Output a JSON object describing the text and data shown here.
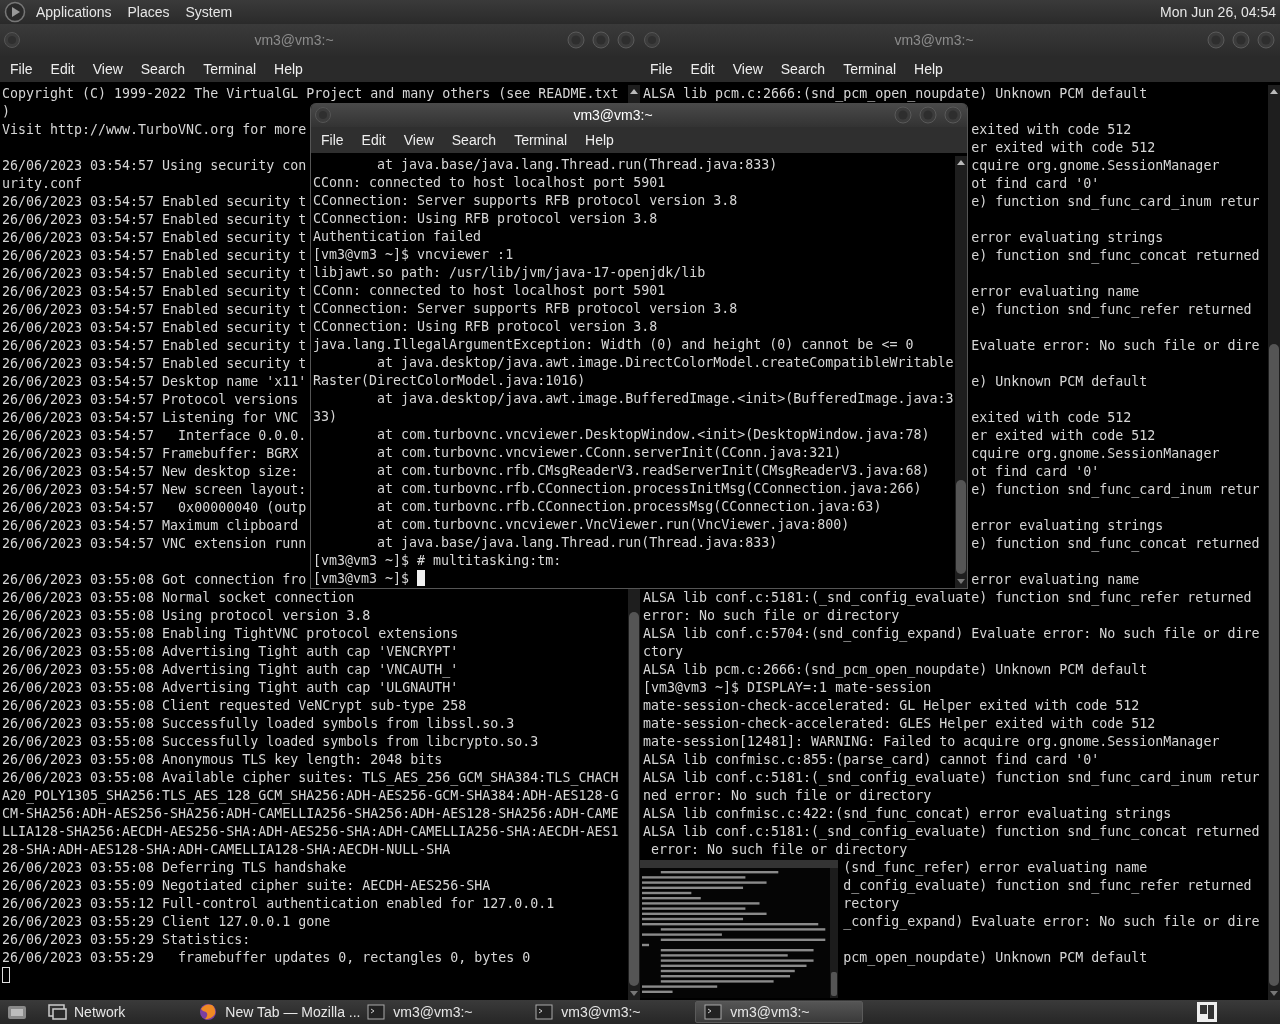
{
  "top_panel": {
    "menus": [
      "Applications",
      "Places",
      "System"
    ],
    "clock": "Mon Jun 26, 04:54"
  },
  "windows": [
    {
      "title": "vm3@vm3:~",
      "active": false,
      "menu": [
        "File",
        "Edit",
        "View",
        "Search",
        "Terminal",
        "Help"
      ],
      "lines": [
        {
          "kind": "line",
          "text": "Copyright (C) 1999-2022 The VirtualGL Project and many others (see README.txt"
        },
        {
          "kind": "line",
          "text": ")"
        },
        {
          "kind": "line",
          "text": "Visit http://www.TurboVNC.org for more"
        },
        {
          "kind": "blank"
        },
        {
          "kind": "line",
          "text": "26/06/2023 03:54:57 Using security con"
        },
        {
          "kind": "line",
          "text": "urity.conf"
        },
        {
          "kind": "line",
          "text": "26/06/2023 03:54:57 Enabled security t"
        },
        {
          "kind": "line",
          "text": "26/06/2023 03:54:57 Enabled security t"
        },
        {
          "kind": "line",
          "text": "26/06/2023 03:54:57 Enabled security t"
        },
        {
          "kind": "line",
          "text": "26/06/2023 03:54:57 Enabled security t"
        },
        {
          "kind": "line",
          "text": "26/06/2023 03:54:57 Enabled security t"
        },
        {
          "kind": "line",
          "text": "26/06/2023 03:54:57 Enabled security t"
        },
        {
          "kind": "line",
          "text": "26/06/2023 03:54:57 Enabled security t"
        },
        {
          "kind": "line",
          "text": "26/06/2023 03:54:57 Enabled security t"
        },
        {
          "kind": "line",
          "text": "26/06/2023 03:54:57 Enabled security t"
        },
        {
          "kind": "line",
          "text": "26/06/2023 03:54:57 Enabled security t"
        },
        {
          "kind": "line",
          "text": "26/06/2023 03:54:57 Desktop name 'x11'"
        },
        {
          "kind": "line",
          "text": "26/06/2023 03:54:57 Protocol versions"
        },
        {
          "kind": "line",
          "text": "26/06/2023 03:54:57 Listening for VNC"
        },
        {
          "kind": "line",
          "text": "26/06/2023 03:54:57   Interface 0.0.0."
        },
        {
          "kind": "line",
          "text": "26/06/2023 03:54:57 Framebuffer: BGRX"
        },
        {
          "kind": "line",
          "text": "26/06/2023 03:54:57 New desktop size:"
        },
        {
          "kind": "line",
          "text": "26/06/2023 03:54:57 New screen layout:"
        },
        {
          "kind": "line",
          "text": "26/06/2023 03:54:57   0x00000040 (outp"
        },
        {
          "kind": "line",
          "text": "26/06/2023 03:54:57 Maximum clipboard"
        },
        {
          "kind": "line",
          "text": "26/06/2023 03:54:57 VNC extension runn"
        },
        {
          "kind": "blank"
        },
        {
          "kind": "line",
          "text": "26/06/2023 03:55:08 Got connection fro"
        },
        {
          "kind": "line",
          "text": "26/06/2023 03:55:08 Normal socket connection"
        },
        {
          "kind": "line",
          "text": "26/06/2023 03:55:08 Using protocol version 3.8"
        },
        {
          "kind": "line",
          "text": "26/06/2023 03:55:08 Enabling TightVNC protocol extensions"
        },
        {
          "kind": "line",
          "text": "26/06/2023 03:55:08 Advertising Tight auth cap 'VENCRYPT'"
        },
        {
          "kind": "line",
          "text": "26/06/2023 03:55:08 Advertising Tight auth cap 'VNCAUTH_'"
        },
        {
          "kind": "line",
          "text": "26/06/2023 03:55:08 Advertising Tight auth cap 'ULGNAUTH'"
        },
        {
          "kind": "line",
          "text": "26/06/2023 03:55:08 Client requested VeNCrypt sub-type 258"
        },
        {
          "kind": "line",
          "text": "26/06/2023 03:55:08 Successfully loaded symbols from libssl.so.3"
        },
        {
          "kind": "line",
          "text": "26/06/2023 03:55:08 Successfully loaded symbols from libcrypto.so.3"
        },
        {
          "kind": "line",
          "text": "26/06/2023 03:55:08 Anonymous TLS key length: 2048 bits"
        },
        {
          "kind": "line",
          "text": "26/06/2023 03:55:08 Available cipher suites: TLS_AES_256_GCM_SHA384:TLS_CHACH"
        },
        {
          "kind": "line",
          "text": "A20_POLY1305_SHA256:TLS_AES_128_GCM_SHA256:ADH-AES256-GCM-SHA384:ADH-AES128-G"
        },
        {
          "kind": "line",
          "text": "CM-SHA256:ADH-AES256-SHA256:ADH-CAMELLIA256-SHA256:ADH-AES128-SHA256:ADH-CAME"
        },
        {
          "kind": "line",
          "text": "LLIA128-SHA256:AECDH-AES256-SHA:ADH-AES256-SHA:ADH-CAMELLIA256-SHA:AECDH-AES1"
        },
        {
          "kind": "line",
          "text": "28-SHA:ADH-AES128-SHA:ADH-CAMELLIA128-SHA:AECDH-NULL-SHA"
        },
        {
          "kind": "line",
          "text": "26/06/2023 03:55:08 Deferring TLS handshake"
        },
        {
          "kind": "line",
          "text": "26/06/2023 03:55:09 Negotiated cipher suite: AECDH-AES256-SHA"
        },
        {
          "kind": "line",
          "text": "26/06/2023 03:55:12 Full-control authentication enabled for 127.0.0.1"
        },
        {
          "kind": "line",
          "text": "26/06/2023 03:55:29 Client 127.0.0.1 gone"
        },
        {
          "kind": "line",
          "text": "26/06/2023 03:55:29 Statistics:"
        },
        {
          "kind": "line",
          "text": "26/06/2023 03:55:29   framebuffer updates 0, rectangles 0, bytes 0"
        },
        {
          "kind": "line",
          "cursor": true
        }
      ]
    },
    {
      "title": "vm3@vm3:~",
      "active": false,
      "menu": [
        "File",
        "Edit",
        "View",
        "Search",
        "Terminal",
        "Help"
      ],
      "lines": [
        {
          "kind": "line",
          "text": "ALSA lib pcm.c:2666:(snd_pcm_open_noupdate) Unknown PCM default"
        },
        {
          "kind": "covered"
        },
        {
          "kind": "behind-window",
          "text": "exited with code 512"
        },
        {
          "kind": "behind-window",
          "text": "er exited with code 512"
        },
        {
          "kind": "behind-window",
          "text": "cquire org.gnome.SessionManager"
        },
        {
          "kind": "behind-window",
          "text": "ot find card '0'"
        },
        {
          "kind": "behind-window",
          "text": "e) function snd_func_card_inum retur"
        },
        {
          "kind": "covered"
        },
        {
          "kind": "behind-window",
          "text": "error evaluating strings"
        },
        {
          "kind": "behind-window",
          "text": "e) function snd_func_concat returned"
        },
        {
          "kind": "covered"
        },
        {
          "kind": "behind-window",
          "text": "error evaluating name"
        },
        {
          "kind": "behind-window",
          "text": "e) function snd_func_refer returned"
        },
        {
          "kind": "covered"
        },
        {
          "kind": "behind-window",
          "text": "Evaluate error: No such file or dire"
        },
        {
          "kind": "covered"
        },
        {
          "kind": "behind-window",
          "text": "e) Unknown PCM default"
        },
        {
          "kind": "covered"
        },
        {
          "kind": "behind-window",
          "text": "exited with code 512"
        },
        {
          "kind": "behind-window",
          "text": "er exited with code 512"
        },
        {
          "kind": "behind-window",
          "text": "cquire org.gnome.SessionManager"
        },
        {
          "kind": "behind-window",
          "text": "ot find card '0'"
        },
        {
          "kind": "behind-window",
          "text": "e) function snd_func_card_inum retur"
        },
        {
          "kind": "covered"
        },
        {
          "kind": "behind-window",
          "text": "error evaluating strings"
        },
        {
          "kind": "behind-window",
          "text": "e) function snd_func_concat returned"
        },
        {
          "kind": "covered"
        },
        {
          "kind": "behind-window",
          "text": "error evaluating name"
        },
        {
          "kind": "line",
          "text": "ALSA lib conf.c:5181:(_snd_config_evaluate) function snd_func_refer returned"
        },
        {
          "kind": "line",
          "text": "error: No such file or directory"
        },
        {
          "kind": "line",
          "text": "ALSA lib conf.c:5704:(snd_config_expand) Evaluate error: No such file or dire"
        },
        {
          "kind": "line",
          "text": "ctory"
        },
        {
          "kind": "line",
          "text": "ALSA lib pcm.c:2666:(snd_pcm_open_noupdate) Unknown PCM default"
        },
        {
          "kind": "line",
          "text": "[vm3@vm3 ~]$ DISPLAY=:1 mate-session"
        },
        {
          "kind": "line",
          "text": "mate-session-check-accelerated: GL Helper exited with code 512"
        },
        {
          "kind": "line",
          "text": "mate-session-check-accelerated: GLES Helper exited with code 512"
        },
        {
          "kind": "line",
          "text": "mate-session[12481]: WARNING: Failed to acquire org.gnome.SessionManager"
        },
        {
          "kind": "line",
          "text": "ALSA lib confmisc.c:855:(parse_card) cannot find card '0'"
        },
        {
          "kind": "line",
          "text": "ALSA lib conf.c:5181:(_snd_config_evaluate) function snd_func_card_inum retur"
        },
        {
          "kind": "line",
          "text": "ned error: No such file or directory"
        },
        {
          "kind": "line",
          "text": "ALSA lib confmisc.c:422:(snd_func_concat) error evaluating strings"
        },
        {
          "kind": "line",
          "text": "ALSA lib conf.c:5181:(_snd_config_evaluate) function snd_func_concat returned"
        },
        {
          "kind": "line",
          "text": " error: No such file or directory"
        },
        {
          "kind": "behind-preview",
          "text": "(snd_func_refer) error evaluating name"
        },
        {
          "kind": "behind-preview",
          "text": "d_config_evaluate) function snd_func_refer returned"
        },
        {
          "kind": "behind-preview",
          "text": "rectory"
        },
        {
          "kind": "behind-preview",
          "text": "_config_expand) Evaluate error: No such file or dire"
        },
        {
          "kind": "covered"
        },
        {
          "kind": "behind-preview",
          "text": "pcm_open_noupdate) Unknown PCM default"
        }
      ]
    },
    {
      "title": "vm3@vm3:~",
      "active": true,
      "menu": [
        "File",
        "Edit",
        "View",
        "Search",
        "Terminal",
        "Help"
      ],
      "lines": [
        {
          "kind": "line",
          "text": "        at java.base/java.lang.Thread.run(Thread.java:833)"
        },
        {
          "kind": "line",
          "text": "CConn: connected to host localhost port 5901"
        },
        {
          "kind": "line",
          "text": "CConnection: Server supports RFB protocol version 3.8"
        },
        {
          "kind": "line",
          "text": "CConnection: Using RFB protocol version 3.8"
        },
        {
          "kind": "line",
          "text": "Authentication failed"
        },
        {
          "kind": "line",
          "text": "[vm3@vm3 ~]$ vncviewer :1"
        },
        {
          "kind": "line",
          "text": "libjawt.so path: /usr/lib/jvm/java-17-openjdk/lib"
        },
        {
          "kind": "line",
          "text": "CConn: connected to host localhost port 5901"
        },
        {
          "kind": "line",
          "text": "CConnection: Server supports RFB protocol version 3.8"
        },
        {
          "kind": "line",
          "text": "CConnection: Using RFB protocol version 3.8"
        },
        {
          "kind": "line",
          "text": "java.lang.IllegalArgumentException: Width (0) and height (0) cannot be <= 0"
        },
        {
          "kind": "line",
          "text": "        at java.desktop/java.awt.image.DirectColorModel.createCompatibleWritable"
        },
        {
          "kind": "line",
          "text": "Raster(DirectColorModel.java:1016)"
        },
        {
          "kind": "line",
          "text": "        at java.desktop/java.awt.image.BufferedImage.<init>(BufferedImage.java:3"
        },
        {
          "kind": "line",
          "text": "33)"
        },
        {
          "kind": "line",
          "text": "        at com.turbovnc.vncviewer.DesktopWindow.<init>(DesktopWindow.java:78)"
        },
        {
          "kind": "line",
          "text": "        at com.turbovnc.vncviewer.CConn.serverInit(CConn.java:321)"
        },
        {
          "kind": "line",
          "text": "        at com.turbovnc.rfb.CMsgReaderV3.readServerInit(CMsgReaderV3.java:68)"
        },
        {
          "kind": "line",
          "text": "        at com.turbovnc.rfb.CConnection.processInitMsg(CConnection.java:266)"
        },
        {
          "kind": "line",
          "text": "        at com.turbovnc.rfb.CConnection.processMsg(CConnection.java:63)"
        },
        {
          "kind": "line",
          "text": "        at com.turbovnc.vncviewer.VncViewer.run(VncViewer.java:800)"
        },
        {
          "kind": "line",
          "text": "        at java.base/java.lang.Thread.run(Thread.java:833)"
        },
        {
          "kind": "line",
          "text": "[vm3@vm3 ~]$ # multitasking:tm:"
        },
        {
          "kind": "line",
          "text": "[vm3@vm3 ~]$ ",
          "cursor": true
        }
      ]
    }
  ],
  "window_preview": {
    "visible": true
  },
  "taskbar": {
    "items": [
      {
        "kind": "desktop"
      },
      {
        "kind": "launcher",
        "label": "Network",
        "selected": false
      },
      {
        "kind": "browser",
        "label": "New Tab — Mozilla ...",
        "selected": false
      },
      {
        "kind": "terminal",
        "label": "vm3@vm3:~",
        "selected": false
      },
      {
        "kind": "terminal",
        "label": "vm3@vm3:~",
        "selected": false
      },
      {
        "kind": "terminal",
        "label": "vm3@vm3:~",
        "selected": true
      }
    ]
  }
}
